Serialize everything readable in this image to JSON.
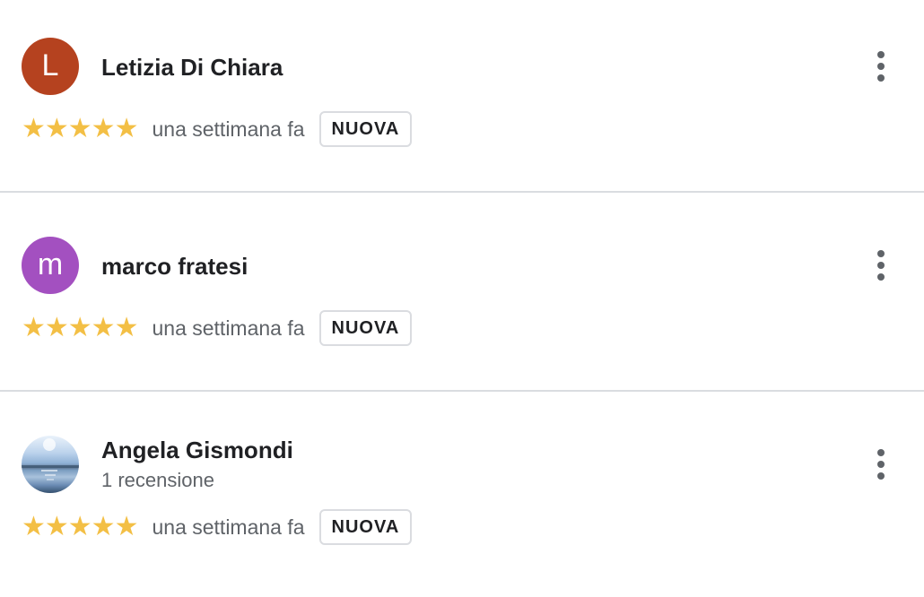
{
  "reviews": [
    {
      "initial": "L",
      "avatar_color": "#b5421f",
      "name": "Letizia Di Chiara",
      "subtitle": "",
      "rating": 5,
      "stars": "★★★★★",
      "time": "una settimana fa",
      "badge": "NUOVA",
      "more_icon": "more-vert-icon"
    },
    {
      "initial": "m",
      "avatar_color": "#a350c0",
      "name": "marco fratesi",
      "subtitle": "",
      "rating": 5,
      "stars": "★★★★★",
      "time": "una settimana fa",
      "badge": "NUOVA",
      "more_icon": "more-vert-icon"
    },
    {
      "initial": "",
      "avatar_color": "",
      "name": "Angela Gismondi",
      "subtitle": "1 recensione",
      "rating": 5,
      "stars": "★★★★★",
      "time": "una settimana fa",
      "badge": "NUOVA",
      "more_icon": "more-vert-icon"
    }
  ],
  "colors": {
    "star": "#f3bf45",
    "divider": "#dadce0",
    "secondary_text": "#5f6368"
  }
}
